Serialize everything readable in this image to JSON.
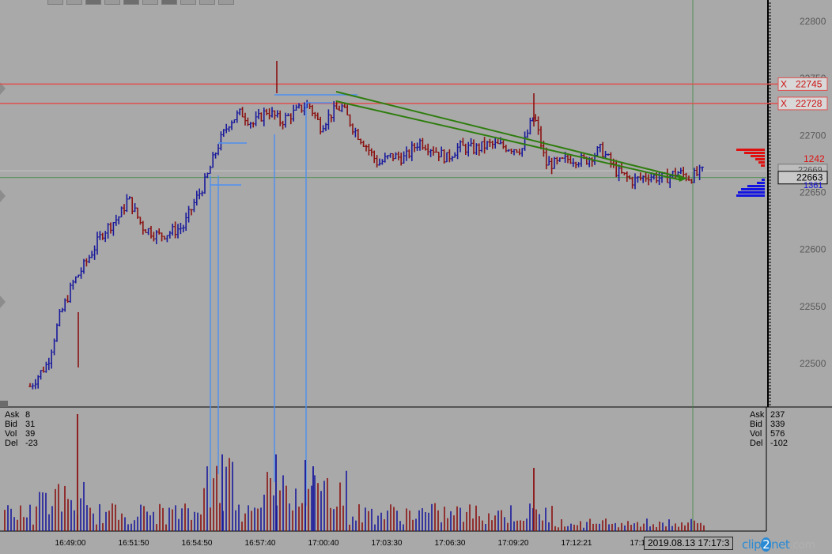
{
  "chart_data": {
    "type": "bar",
    "price_axis": {
      "ticks": [
        "22800",
        "22750",
        "22700",
        "22650",
        "22600",
        "22550",
        "22500"
      ]
    },
    "time_axis": {
      "ticks": [
        "16:49:00",
        "16:51:50",
        "16:54:50",
        "16:57:40",
        "17:00:40",
        "17:03:30",
        "17:06:30",
        "17:09:20",
        "17:12:21",
        "17:15"
      ]
    },
    "levels": [
      {
        "label": "X",
        "price": "22745",
        "color": "#e05050"
      },
      {
        "label": "X",
        "price": "22728",
        "color": "#e05050"
      }
    ],
    "current_price": "22663",
    "hidden_price": "22669",
    "book": {
      "ask": "1242",
      "bid": "1361"
    },
    "info_left": {
      "ask": {
        "k": "Ask",
        "v": "8"
      },
      "bid": {
        "k": "Bid",
        "v": "31"
      },
      "vol": {
        "k": "Vol",
        "v": "39"
      },
      "del": {
        "k": "Del",
        "v": "-23"
      }
    },
    "info_right": {
      "ask": {
        "k": "Ask",
        "v": "237"
      },
      "bid": {
        "k": "Bid",
        "v": "339"
      },
      "vol": {
        "k": "Vol",
        "v": "576"
      },
      "del": {
        "k": "Del",
        "v": "-102"
      }
    },
    "timestamp": "2019.08.13 17:17:3",
    "colors": {
      "up": "#1a1a9c",
      "down": "#8b1111",
      "level": "#e05050",
      "trend": "#2e7d0e",
      "marker": "#4d8ff0",
      "crosshair": "#3d8a3d"
    }
  },
  "watermark": {
    "a": "clip",
    "b": "2",
    "c": "net",
    "d": ".com"
  }
}
